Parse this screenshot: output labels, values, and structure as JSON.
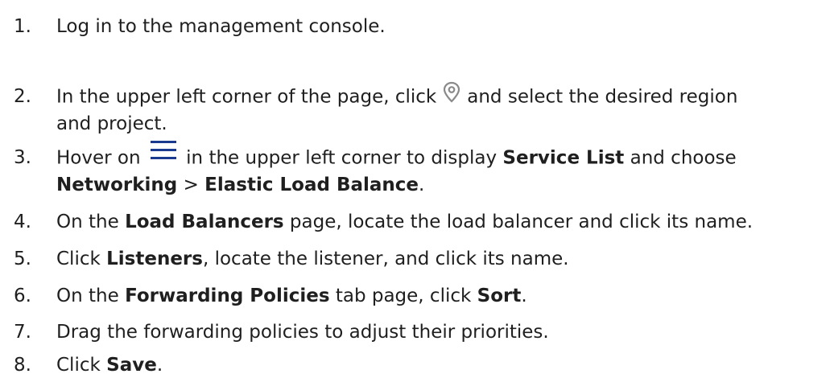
{
  "steps": [
    {
      "num": "1.",
      "text": "Log in to the management console."
    },
    {
      "num": "2.",
      "before": "In the upper left corner of the page, click",
      "after": "and select the desired region",
      "line2": "and project.",
      "icon": "location-pin-icon"
    },
    {
      "num": "3.",
      "before": "Hover on",
      "mid1": "in the upper left corner to display",
      "b1": "Service List",
      "mid2": "and choose",
      "b2": "Networking",
      "sep": ">",
      "b3": "Elastic Load Balance",
      "end": ".",
      "icon": "hamburger-menu-icon"
    },
    {
      "num": "4.",
      "before": "On the",
      "b1": "Load Balancers",
      "after": "page, locate the load balancer and click its name."
    },
    {
      "num": "5.",
      "before": "Click",
      "b1": "Listeners",
      "after": ", locate the listener, and click its name."
    },
    {
      "num": "6.",
      "before": "On the",
      "b1": "Forwarding Policies",
      "mid": "tab page, click",
      "b2": "Sort",
      "end": "."
    },
    {
      "num": "7.",
      "text": "Drag the forwarding policies to adjust their priorities."
    },
    {
      "num": "8.",
      "before": "Click",
      "b1": "Save",
      "end": "."
    }
  ],
  "colors": {
    "text": "#1f1f1f",
    "icon_gray": "#8a8a8a",
    "menu_icon": "#1a3a8f"
  }
}
